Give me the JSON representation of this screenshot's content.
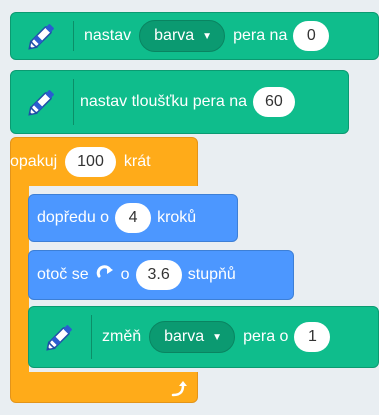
{
  "blocks": {
    "set_pen": {
      "label1": "nastav",
      "dropdown": "barva",
      "label2": "pera na",
      "value": "0"
    },
    "set_size": {
      "label": "nastav tloušťku pera na",
      "value": "60"
    },
    "repeat": {
      "label1": "opakuj",
      "value": "100",
      "label2": "krát"
    },
    "move": {
      "label1": "dopředu o",
      "value": "4",
      "label2": "kroků"
    },
    "turn": {
      "label1": "otoč se",
      "label2": "o",
      "value": "3.6",
      "label3": "stupňů"
    },
    "change_pen": {
      "label1": "změň",
      "dropdown": "barva",
      "label2": "pera o",
      "value": "1"
    }
  },
  "colors": {
    "pen": "#0fbd8c",
    "control": "#ffab19",
    "motion": "#4c97ff"
  },
  "icons": {
    "pen": "pen-icon",
    "rotate": "rotate-clockwise-icon",
    "loop": "loop-arrow-icon"
  }
}
